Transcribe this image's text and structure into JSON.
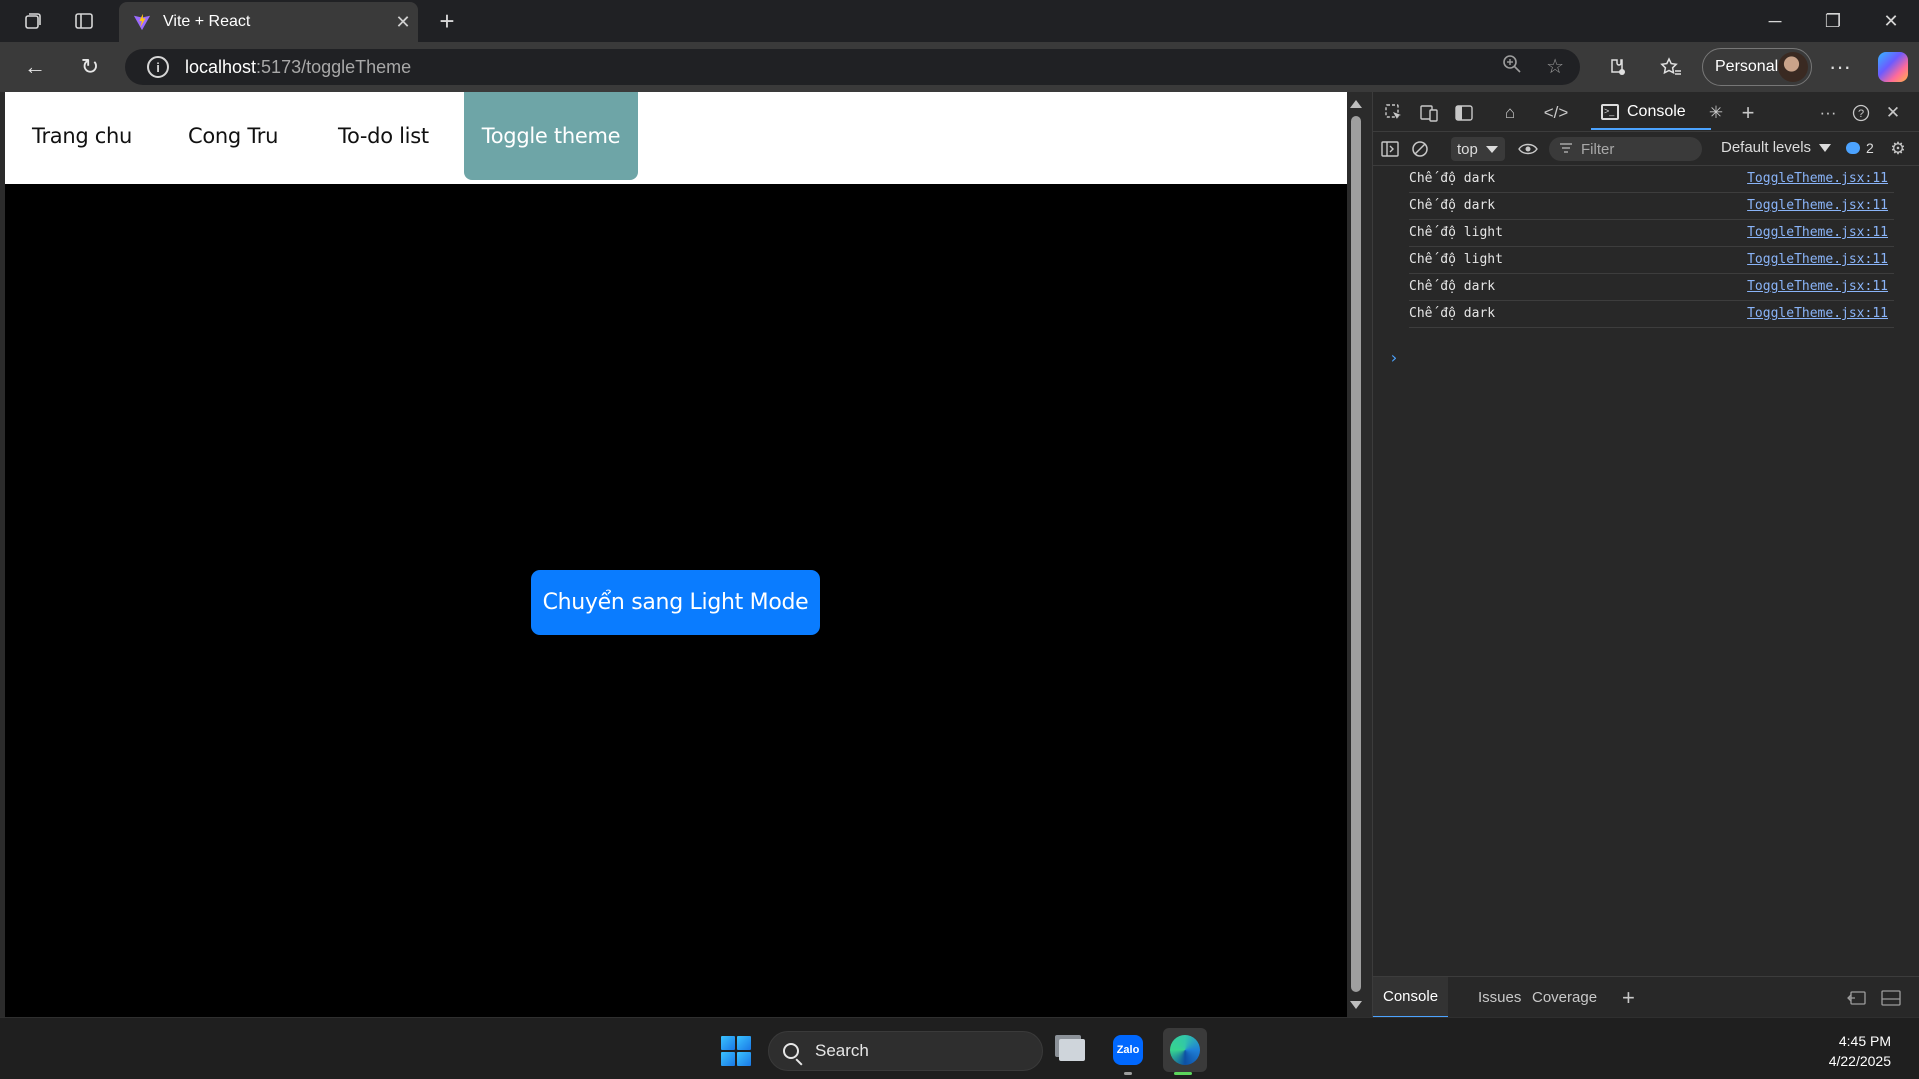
{
  "browser": {
    "tab": {
      "title": "Vite + React",
      "favicon": "vite-icon"
    },
    "address": {
      "host": "localhost",
      "path": ":5173/toggleTheme"
    },
    "profile_label": "Personal",
    "icons": {
      "workspaces": "workspaces-icon",
      "tab_actions": "tab-actions-icon",
      "back": "back-arrow-icon",
      "reload": "reload-icon",
      "site_info": "info-icon",
      "zoom": "zoom-icon",
      "favorite": "star-icon",
      "extensions": "extensions-icon",
      "favorites": "favorites-icon",
      "more": "more-icon",
      "copilot": "copilot-icon"
    }
  },
  "page": {
    "nav": {
      "items": [
        {
          "label": "Trang chu"
        },
        {
          "label": "Cong Tru"
        },
        {
          "label": "To-do list"
        },
        {
          "label": "Toggle theme",
          "active": true
        }
      ]
    },
    "toggle_button_label": "Chuyển sang Light Mode",
    "colors": {
      "background": "#000000",
      "nav_active": "#6ea5a7",
      "button": "#0a7cff"
    }
  },
  "devtools": {
    "active_tab": "Console",
    "context": "top",
    "filter_placeholder": "Filter",
    "levels_label": "Default levels",
    "issues_count": "2",
    "logs": [
      {
        "message": "Chế độ dark",
        "source": "ToggleTheme.jsx:11"
      },
      {
        "message": "Chế độ dark",
        "source": "ToggleTheme.jsx:11"
      },
      {
        "message": "Chế độ light",
        "source": "ToggleTheme.jsx:11"
      },
      {
        "message": "Chế độ light",
        "source": "ToggleTheme.jsx:11"
      },
      {
        "message": "Chế độ dark",
        "source": "ToggleTheme.jsx:11"
      },
      {
        "message": "Chế độ dark",
        "source": "ToggleTheme.jsx:11"
      }
    ],
    "drawer_tabs": [
      {
        "label": "Console",
        "active": true
      },
      {
        "label": "Issues"
      },
      {
        "label": "Coverage"
      }
    ]
  },
  "taskbar": {
    "search_label": "Search",
    "apps": [
      "file-explorer-icon",
      "zalo-icon",
      "edge-icon"
    ],
    "zalo_text": "Zalo",
    "time": "4:45 PM",
    "date": "4/22/2025"
  }
}
